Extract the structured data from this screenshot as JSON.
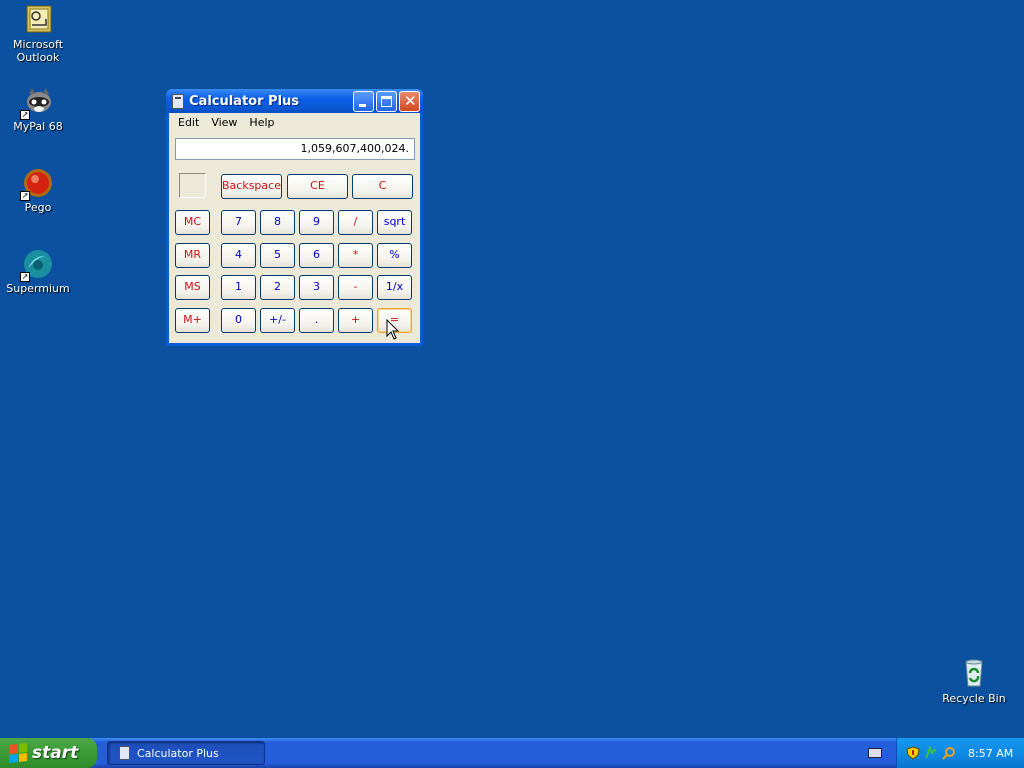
{
  "desktop": {
    "icons": [
      {
        "label_line1": "Microsoft",
        "label_line2": "Outlook"
      },
      {
        "label_line1": "MyPal 68"
      },
      {
        "label_line1": "Pego"
      },
      {
        "label_line1": "Supermium"
      }
    ],
    "recycle_bin": "Recycle Bin",
    "background_color": "#0b519f"
  },
  "window": {
    "title": "Calculator Plus",
    "menu": [
      "Edit",
      "View",
      "Help"
    ],
    "display_value": "1,059,607,400,024.",
    "buttons": {
      "backspace": "Backspace",
      "ce": "CE",
      "c": "C",
      "mc": "MC",
      "mr": "MR",
      "ms": "MS",
      "mplus": "M+",
      "n7": "7",
      "n8": "8",
      "n9": "9",
      "div": "/",
      "sqrt": "sqrt",
      "n4": "4",
      "n5": "5",
      "n6": "6",
      "mul": "*",
      "pct": "%",
      "n1": "1",
      "n2": "2",
      "n3": "3",
      "sub": "-",
      "inv": "1/x",
      "n0": "0",
      "sign": "+/-",
      "dot": ".",
      "add": "+",
      "eq": "="
    }
  },
  "taskbar": {
    "start_label": "start",
    "task_label": "Calculator Plus",
    "clock": "8:57 AM"
  }
}
